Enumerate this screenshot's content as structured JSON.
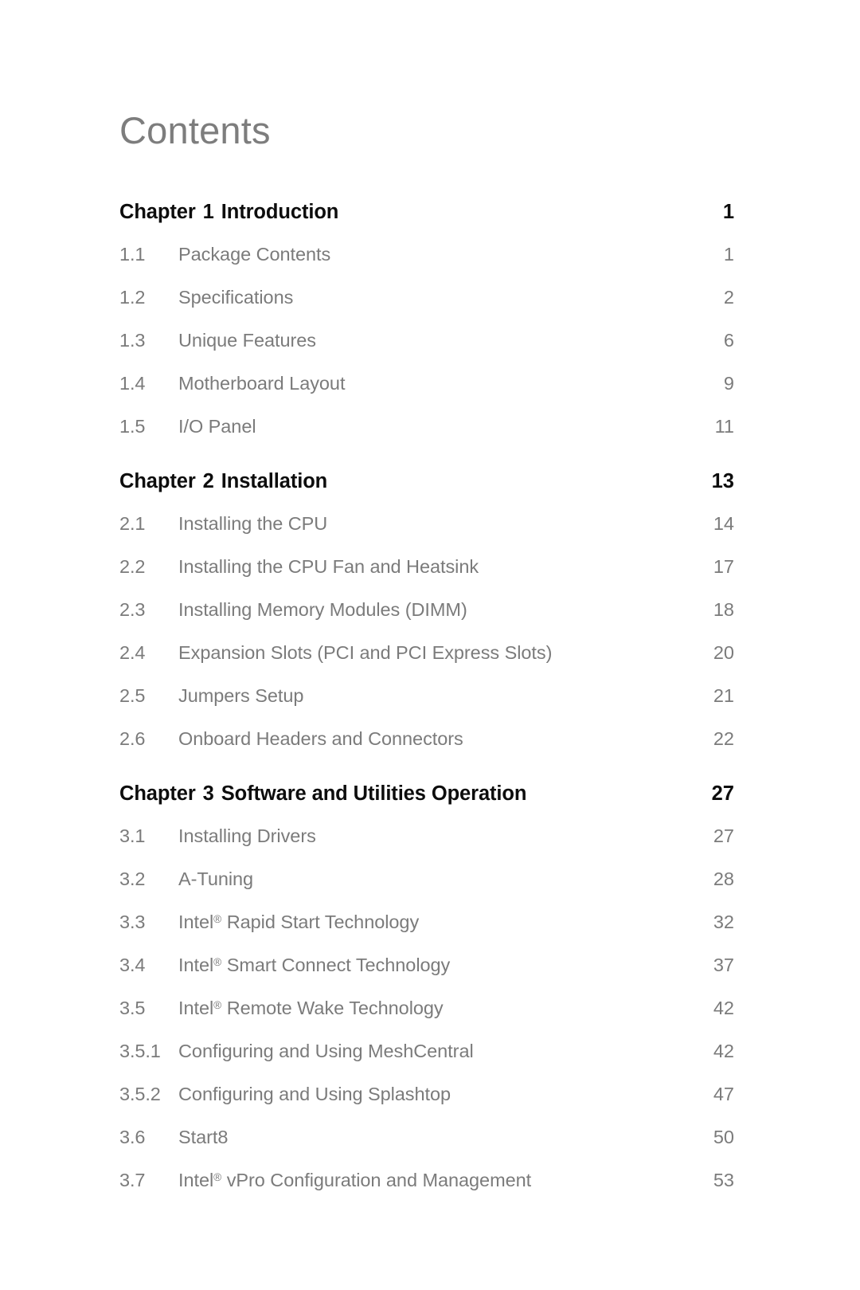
{
  "page": {
    "title": "Contents",
    "background_color": "#ffffff",
    "chapter_text_color": "#0d0d0d",
    "section_text_color": "#7b7b7b",
    "title_color": "#7d7d7d"
  },
  "toc": {
    "entries": [
      {
        "kind": "chapter",
        "label": "Chapter",
        "number": "1",
        "title": "Introduction",
        "page": "1"
      },
      {
        "kind": "section",
        "number": "1.1",
        "title": "Package Contents",
        "page": "1"
      },
      {
        "kind": "section",
        "number": "1.2",
        "title": "Specifications",
        "page": "2"
      },
      {
        "kind": "section",
        "number": "1.3",
        "title": "Unique Features",
        "page": "6"
      },
      {
        "kind": "section",
        "number": "1.4",
        "title": "Motherboard Layout",
        "page": "9"
      },
      {
        "kind": "section",
        "number": "1.5",
        "title": "I/O Panel",
        "page": "11"
      },
      {
        "kind": "chapter",
        "label": "Chapter",
        "number": "2",
        "title": "Installation",
        "page": "13"
      },
      {
        "kind": "section",
        "number": "2.1",
        "title": "Installing the CPU",
        "page": "14"
      },
      {
        "kind": "section",
        "number": "2.2",
        "title": "Installing the CPU Fan and Heatsink",
        "page": "17"
      },
      {
        "kind": "section",
        "number": "2.3",
        "title": "Installing Memory Modules (DIMM)",
        "page": "18"
      },
      {
        "kind": "section",
        "number": "2.4",
        "title": "Expansion Slots (PCI and PCI Express Slots)",
        "page": "20"
      },
      {
        "kind": "section",
        "number": "2.5",
        "title": "Jumpers Setup",
        "page": "21"
      },
      {
        "kind": "section",
        "number": "2.6",
        "title": "Onboard Headers and Connectors",
        "page": "22"
      },
      {
        "kind": "chapter",
        "label": "Chapter",
        "number": "3",
        "title": "Software and Utilities Operation",
        "page": "27"
      },
      {
        "kind": "section",
        "number": "3.1",
        "title": "Installing Drivers",
        "page": "27"
      },
      {
        "kind": "section",
        "number": "3.2",
        "title": "A-Tuning",
        "page": "28"
      },
      {
        "kind": "section",
        "number": "3.3",
        "title_prefix": "Intel",
        "registered": true,
        "title_suffix": " Rapid Start Technology",
        "title": "Intel® Rapid Start Technology",
        "page": "32"
      },
      {
        "kind": "section",
        "number": "3.4",
        "title_prefix": "Intel",
        "registered": true,
        "title_suffix": " Smart Connect Technology",
        "title": "Intel® Smart Connect Technology",
        "page": "37"
      },
      {
        "kind": "section",
        "number": "3.5",
        "title_prefix": "Intel",
        "registered": true,
        "title_suffix": " Remote Wake Technology",
        "title": "Intel® Remote Wake Technology",
        "page": "42"
      },
      {
        "kind": "section",
        "number": "3.5.1",
        "title": "Configuring and Using MeshCentral",
        "page": "42"
      },
      {
        "kind": "section",
        "number": "3.5.2",
        "title": "Configuring and Using Splashtop",
        "page": "47"
      },
      {
        "kind": "section",
        "number": "3.6",
        "title": "Start8",
        "page": "50"
      },
      {
        "kind": "section",
        "number": "3.7",
        "title_prefix": "Intel",
        "registered": true,
        "title_suffix": " vPro Configuration and Management",
        "title": "Intel® vPro Configuration and Management",
        "page": "53"
      }
    ]
  }
}
